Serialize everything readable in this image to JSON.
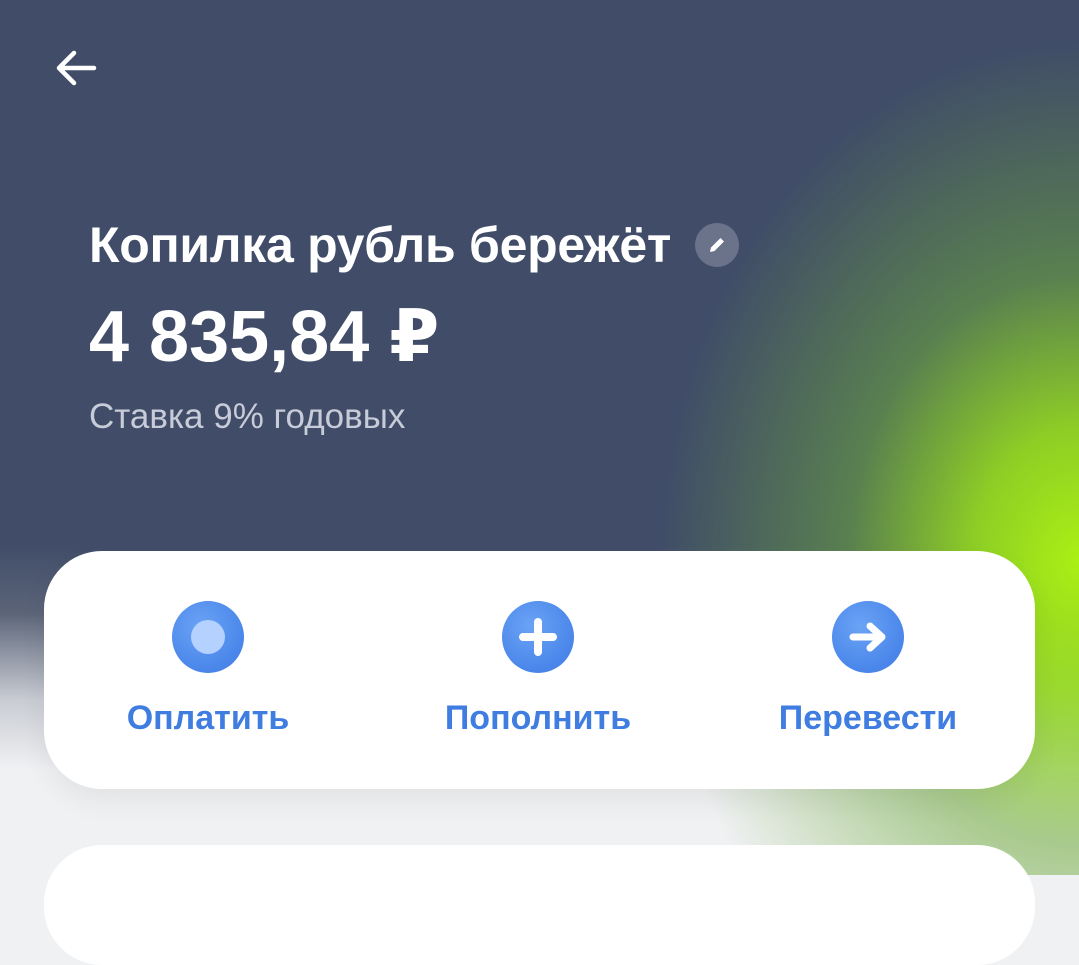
{
  "header": {
    "back_icon": "arrow-left-icon"
  },
  "account": {
    "title": "Копилка рубль бережёт",
    "edit_icon": "pencil-icon",
    "balance": "4 835,84 ₽",
    "rate": "Ставка 9% годовых"
  },
  "actions": [
    {
      "label": "Оплатить",
      "icon": "dot-icon"
    },
    {
      "label": "Пополнить",
      "icon": "plus-icon"
    },
    {
      "label": "Перевести",
      "icon": "arrow-right-icon"
    }
  ],
  "colors": {
    "header_bg": "#404c68",
    "accent_green": "#a8ee14",
    "action_blue": "#4a86ea",
    "label_blue": "#3f7de0"
  }
}
